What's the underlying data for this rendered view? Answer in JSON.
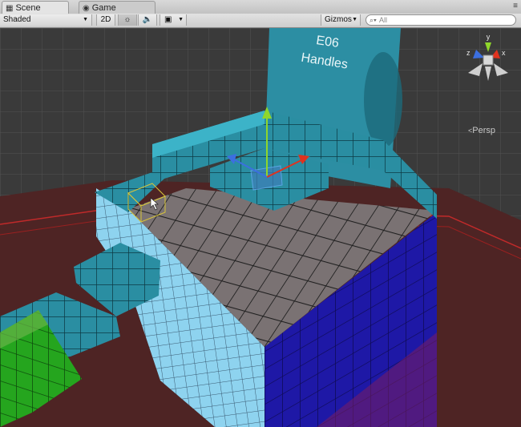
{
  "tabs": [
    {
      "label": "Scene",
      "icon": "scene-icon",
      "active": true
    },
    {
      "label": "Game",
      "icon": "game-icon",
      "active": false
    }
  ],
  "toolbar": {
    "shading_mode": "Shaded",
    "mode_2d": "2D",
    "lighting_icon": "sun-icon",
    "audio_icon": "speaker-icon",
    "effects_icon": "image-icon",
    "gizmos_label": "Gizmos",
    "search_placeholder": "All"
  },
  "scene": {
    "sign_line1": "E06",
    "sign_line2": "Handles",
    "camera_label": "Persp"
  },
  "gizmo_axes": {
    "y": "y",
    "x": "x",
    "z": "z",
    "colors": {
      "x": "#e0321e",
      "y": "#8fd62b",
      "z": "#3c6fe0"
    }
  },
  "colors": {
    "voxel_teal": "#2a8da0",
    "voxel_top": "#7b7374",
    "voxel_light_blue": "#8fd3ef",
    "voxel_dark_blue": "#1f1aa8",
    "green_ramp": "#22a21e",
    "floor": "#4d2626",
    "selection": "#d7c43a"
  }
}
